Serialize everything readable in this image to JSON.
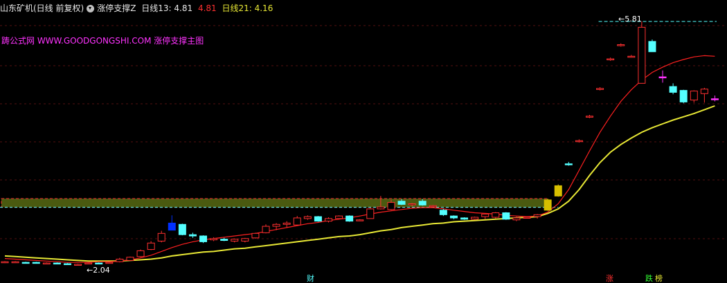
{
  "header": {
    "stock": "山东矿机(日线 前复权)",
    "indicator": "涨停支撑Z",
    "ma13_label": "日线13: 4.81",
    "ma13_cur": "4.81",
    "ma21_label": "日线21: 4.16"
  },
  "watermark": "踌公式网 WWW.GOODGONGSHI.COM 涨停支撑主图",
  "markers": {
    "high": "5.81",
    "low": "2.04"
  },
  "tags": {
    "cai": "财",
    "zhang": "涨",
    "die": "跌",
    "bang": "榜"
  },
  "colors": {
    "up": "#ff3030",
    "down": "#54ffff",
    "ma13": "#ff2020",
    "ma21": "#e8e835",
    "zone_fill": "#4a5a10",
    "zone_border": "#ff3030",
    "magenta": "#ff33ff"
  },
  "chart_data": {
    "type": "candlestick",
    "price_range": [
      1.9,
      5.95
    ],
    "support_zone": [
      2.925,
      3.06
    ],
    "resistance_level": 5.81,
    "candles": [
      {
        "o": 2.07,
        "h": 2.09,
        "l": 2.06,
        "c": 2.08
      },
      {
        "o": 2.08,
        "h": 2.09,
        "l": 2.07,
        "c": 2.08
      },
      {
        "o": 2.07,
        "h": 2.08,
        "l": 2.06,
        "c": 2.06
      },
      {
        "o": 2.07,
        "h": 2.08,
        "l": 2.05,
        "c": 2.06
      },
      {
        "o": 2.05,
        "h": 2.07,
        "l": 2.04,
        "c": 2.06
      },
      {
        "o": 2.06,
        "h": 2.07,
        "l": 2.05,
        "c": 2.05
      },
      {
        "o": 2.05,
        "h": 2.06,
        "l": 2.04,
        "c": 2.04
      },
      {
        "o": 2.04,
        "h": 2.05,
        "l": 2.03,
        "c": 2.04
      },
      {
        "o": 2.05,
        "h": 2.07,
        "l": 2.04,
        "c": 2.06
      },
      {
        "o": 2.06,
        "h": 2.07,
        "l": 2.05,
        "c": 2.05
      },
      {
        "o": 2.06,
        "h": 2.08,
        "l": 2.05,
        "c": 2.07
      },
      {
        "o": 2.08,
        "h": 2.14,
        "l": 2.07,
        "c": 2.12
      },
      {
        "o": 2.1,
        "h": 2.16,
        "l": 2.09,
        "c": 2.15
      },
      {
        "o": 2.16,
        "h": 2.27,
        "l": 2.15,
        "c": 2.25
      },
      {
        "o": 2.27,
        "h": 2.4,
        "l": 2.26,
        "c": 2.37
      },
      {
        "o": 2.4,
        "h": 2.56,
        "l": 2.38,
        "c": 2.52
      },
      {
        "o": 2.68,
        "h": 2.8,
        "l": 2.58,
        "c": 2.57
      },
      {
        "o": 2.66,
        "h": 2.67,
        "l": 2.49,
        "c": 2.5
      },
      {
        "o": 2.5,
        "h": 2.53,
        "l": 2.45,
        "c": 2.48
      },
      {
        "o": 2.48,
        "h": 2.49,
        "l": 2.37,
        "c": 2.39
      },
      {
        "o": 2.42,
        "h": 2.46,
        "l": 2.4,
        "c": 2.44
      },
      {
        "o": 2.43,
        "h": 2.45,
        "l": 2.4,
        "c": 2.41
      },
      {
        "o": 2.4,
        "h": 2.44,
        "l": 2.38,
        "c": 2.43
      },
      {
        "o": 2.4,
        "h": 2.45,
        "l": 2.38,
        "c": 2.44
      },
      {
        "o": 2.45,
        "h": 2.53,
        "l": 2.44,
        "c": 2.52
      },
      {
        "o": 2.53,
        "h": 2.66,
        "l": 2.52,
        "c": 2.63
      },
      {
        "o": 2.63,
        "h": 2.68,
        "l": 2.57,
        "c": 2.66
      },
      {
        "o": 2.66,
        "h": 2.71,
        "l": 2.61,
        "c": 2.68
      },
      {
        "o": 2.65,
        "h": 2.79,
        "l": 2.64,
        "c": 2.76
      },
      {
        "o": 2.75,
        "h": 2.8,
        "l": 2.73,
        "c": 2.78
      },
      {
        "o": 2.78,
        "h": 2.79,
        "l": 2.7,
        "c": 2.71
      },
      {
        "o": 2.71,
        "h": 2.77,
        "l": 2.69,
        "c": 2.75
      },
      {
        "o": 2.75,
        "h": 2.8,
        "l": 2.74,
        "c": 2.79
      },
      {
        "o": 2.79,
        "h": 2.8,
        "l": 2.7,
        "c": 2.71
      },
      {
        "o": 2.72,
        "h": 2.74,
        "l": 2.71,
        "c": 2.73
      },
      {
        "o": 2.75,
        "h": 2.92,
        "l": 2.75,
        "c": 2.9
      },
      {
        "o": 2.9,
        "h": 3.1,
        "l": 2.89,
        "c": 2.93
      },
      {
        "o": 2.89,
        "h": 3.04,
        "l": 2.88,
        "c": 3.0
      },
      {
        "o": 3.02,
        "h": 3.05,
        "l": 2.96,
        "c": 2.97
      },
      {
        "o": 2.97,
        "h": 2.99,
        "l": 2.94,
        "c": 2.98
      },
      {
        "o": 3.02,
        "h": 3.05,
        "l": 2.95,
        "c": 2.96
      },
      {
        "o": 2.94,
        "h": 2.96,
        "l": 2.93,
        "c": 2.95
      },
      {
        "o": 2.88,
        "h": 2.9,
        "l": 2.79,
        "c": 2.81
      },
      {
        "o": 2.79,
        "h": 2.8,
        "l": 2.74,
        "c": 2.76
      },
      {
        "o": 2.76,
        "h": 2.77,
        "l": 2.73,
        "c": 2.74
      },
      {
        "o": 2.74,
        "h": 2.78,
        "l": 2.73,
        "c": 2.77
      },
      {
        "o": 2.78,
        "h": 2.81,
        "l": 2.74,
        "c": 2.82
      },
      {
        "o": 2.77,
        "h": 2.85,
        "l": 2.75,
        "c": 2.84
      },
      {
        "o": 2.84,
        "h": 2.85,
        "l": 2.73,
        "c": 2.74
      },
      {
        "o": 2.73,
        "h": 2.78,
        "l": 2.71,
        "c": 2.76
      },
      {
        "o": 2.76,
        "h": 2.78,
        "l": 2.75,
        "c": 2.77
      },
      {
        "o": 2.78,
        "h": 2.82,
        "l": 2.75,
        "c": 2.81
      },
      {
        "o": 2.88,
        "h": 3.06,
        "l": 2.87,
        "c": 3.04
      },
      {
        "o": 3.1,
        "h": 3.28,
        "l": 3.09,
        "c": 3.26
      },
      {
        "o": 3.6,
        "h": 3.63,
        "l": 3.57,
        "c": 3.59
      },
      {
        "o": 3.95,
        "h": 3.98,
        "l": 3.93,
        "c": 3.96
      },
      {
        "o": 4.33,
        "h": 4.36,
        "l": 4.31,
        "c": 4.34
      },
      {
        "o": 4.76,
        "h": 4.79,
        "l": 4.74,
        "c": 4.77
      },
      {
        "o": 5.22,
        "h": 5.25,
        "l": 5.2,
        "c": 5.23
      },
      {
        "o": 5.44,
        "h": 5.47,
        "l": 5.42,
        "c": 5.45
      },
      {
        "o": 5.27,
        "h": 5.29,
        "l": 5.25,
        "c": 5.27
      },
      {
        "o": 4.85,
        "h": 5.81,
        "l": 4.85,
        "c": 5.72
      },
      {
        "o": 5.5,
        "h": 5.53,
        "l": 5.34,
        "c": 5.34
      },
      {
        "o": 4.95,
        "h": 5.05,
        "l": 4.86,
        "c": 4.94
      },
      {
        "o": 4.8,
        "h": 4.85,
        "l": 4.68,
        "c": 4.71
      },
      {
        "o": 4.74,
        "h": 4.75,
        "l": 4.54,
        "c": 4.56
      },
      {
        "o": 4.59,
        "h": 4.74,
        "l": 4.55,
        "c": 4.73
      },
      {
        "o": 4.69,
        "h": 4.78,
        "l": 4.55,
        "c": 4.76
      },
      {
        "o": 4.61,
        "h": 4.66,
        "l": 4.57,
        "c": 4.6
      }
    ],
    "ma21": [
      2.17,
      2.16,
      2.15,
      2.14,
      2.13,
      2.12,
      2.11,
      2.1,
      2.09,
      2.09,
      2.09,
      2.09,
      2.1,
      2.11,
      2.12,
      2.14,
      2.17,
      2.19,
      2.21,
      2.23,
      2.24,
      2.26,
      2.28,
      2.29,
      2.31,
      2.33,
      2.35,
      2.37,
      2.39,
      2.41,
      2.43,
      2.45,
      2.47,
      2.48,
      2.5,
      2.53,
      2.56,
      2.58,
      2.61,
      2.63,
      2.65,
      2.67,
      2.68,
      2.7,
      2.71,
      2.72,
      2.73,
      2.74,
      2.75,
      2.76,
      2.77,
      2.78,
      2.83,
      2.9,
      3.02,
      3.2,
      3.42,
      3.62,
      3.78,
      3.9,
      4.0,
      4.09,
      4.16,
      4.22,
      4.28,
      4.33,
      4.38,
      4.44,
      4.5
    ],
    "ma13": [
      2.13,
      2.12,
      2.11,
      2.1,
      2.09,
      2.08,
      2.07,
      2.07,
      2.07,
      2.08,
      2.08,
      2.09,
      2.11,
      2.14,
      2.18,
      2.24,
      2.3,
      2.35,
      2.39,
      2.42,
      2.44,
      2.46,
      2.48,
      2.5,
      2.52,
      2.55,
      2.58,
      2.61,
      2.64,
      2.67,
      2.69,
      2.72,
      2.74,
      2.76,
      2.79,
      2.82,
      2.85,
      2.87,
      2.89,
      2.91,
      2.92,
      2.92,
      2.9,
      2.88,
      2.86,
      2.84,
      2.83,
      2.82,
      2.8,
      2.79,
      2.78,
      2.79,
      2.85,
      2.98,
      3.2,
      3.5,
      3.8,
      4.09,
      4.34,
      4.57,
      4.75,
      4.9,
      5.02,
      5.1,
      5.17,
      5.22,
      5.26,
      5.28,
      5.27
    ]
  }
}
